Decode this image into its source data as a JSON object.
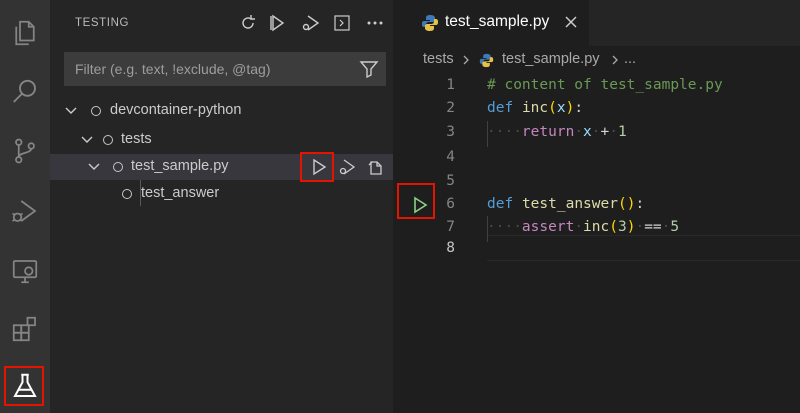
{
  "sidebar": {
    "title": "TESTING",
    "filter": {
      "placeholder": "Filter (e.g. text, !exclude, @tag)"
    },
    "tree": [
      {
        "label": "devcontainer-python"
      },
      {
        "label": "tests"
      },
      {
        "label": "test_sample.py"
      },
      {
        "label": "test_answer"
      }
    ]
  },
  "editor": {
    "tab": {
      "label": "test_sample.py"
    },
    "breadcrumb": {
      "folder": "tests",
      "file": "test_sample.py",
      "more": "..."
    },
    "lines": [
      {
        "num": "1"
      },
      {
        "num": "2"
      },
      {
        "num": "3"
      },
      {
        "num": "4"
      },
      {
        "num": "5"
      },
      {
        "num": "6"
      },
      {
        "num": "7"
      },
      {
        "num": "8"
      }
    ],
    "code": {
      "l1": "# content of test_sample.py",
      "l2_kw": "def",
      "l2_fn": "inc",
      "l2_arg": "x",
      "l3_kw": "return",
      "l3_var": "x",
      "l3_num": "1",
      "l6_kw": "def",
      "l6_fn": "test_answer",
      "l7_kw": "assert",
      "l7_fn": "inc",
      "l7_arg": "3",
      "l7_num": "5"
    }
  },
  "colors": {
    "highlight": "#e51400",
    "run_green": "#89d185",
    "accent": "#569cd6"
  }
}
